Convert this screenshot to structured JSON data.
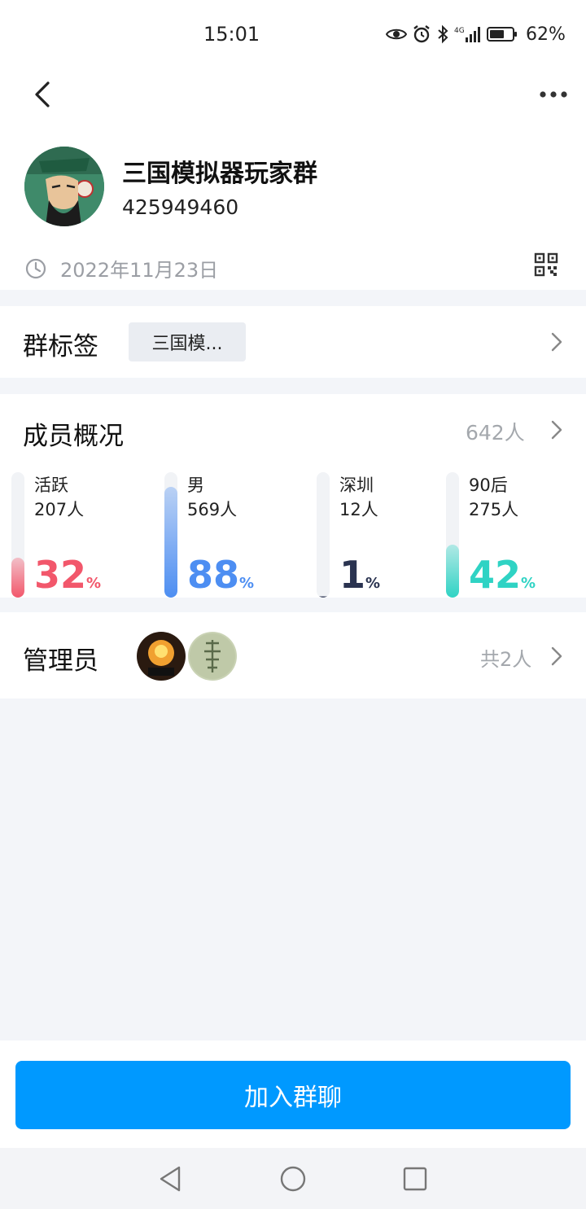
{
  "status_bar": {
    "time": "15:01",
    "battery": "62%",
    "network": "4G",
    "icons": [
      "eye-icon",
      "alarm-icon",
      "bluetooth-icon",
      "signal-icon",
      "battery-icon"
    ]
  },
  "nav": {
    "back_icon": "chevron-left-icon",
    "more_icon": "more-horizontal-icon"
  },
  "group": {
    "name": "三国模拟器玩家群",
    "id": "425949460",
    "created": "2022年11月23日"
  },
  "tags": {
    "label": "群标签",
    "items": [
      "三国模..."
    ]
  },
  "members": {
    "label": "成员概况",
    "total": "642人",
    "stats": [
      {
        "label": "活跃",
        "count": "207人",
        "percent": "32",
        "sign": "%",
        "fill": 0.32,
        "color": "#f2576b"
      },
      {
        "label": "男",
        "count": "569人",
        "percent": "88",
        "sign": "%",
        "fill": 0.88,
        "color": "#4d8ef2"
      },
      {
        "label": "深圳",
        "count": "12人",
        "percent": "1",
        "sign": "%",
        "fill": 0.01,
        "color": "#2a3350"
      },
      {
        "label": "90后",
        "count": "275人",
        "percent": "42",
        "sign": "%",
        "fill": 0.42,
        "color": "#2fd3c4"
      }
    ]
  },
  "admins": {
    "label": "管理员",
    "count": "共2人"
  },
  "join_button": "加入群聊",
  "colors": {
    "accent": "#0099ff",
    "background": "#f3f5f9"
  }
}
